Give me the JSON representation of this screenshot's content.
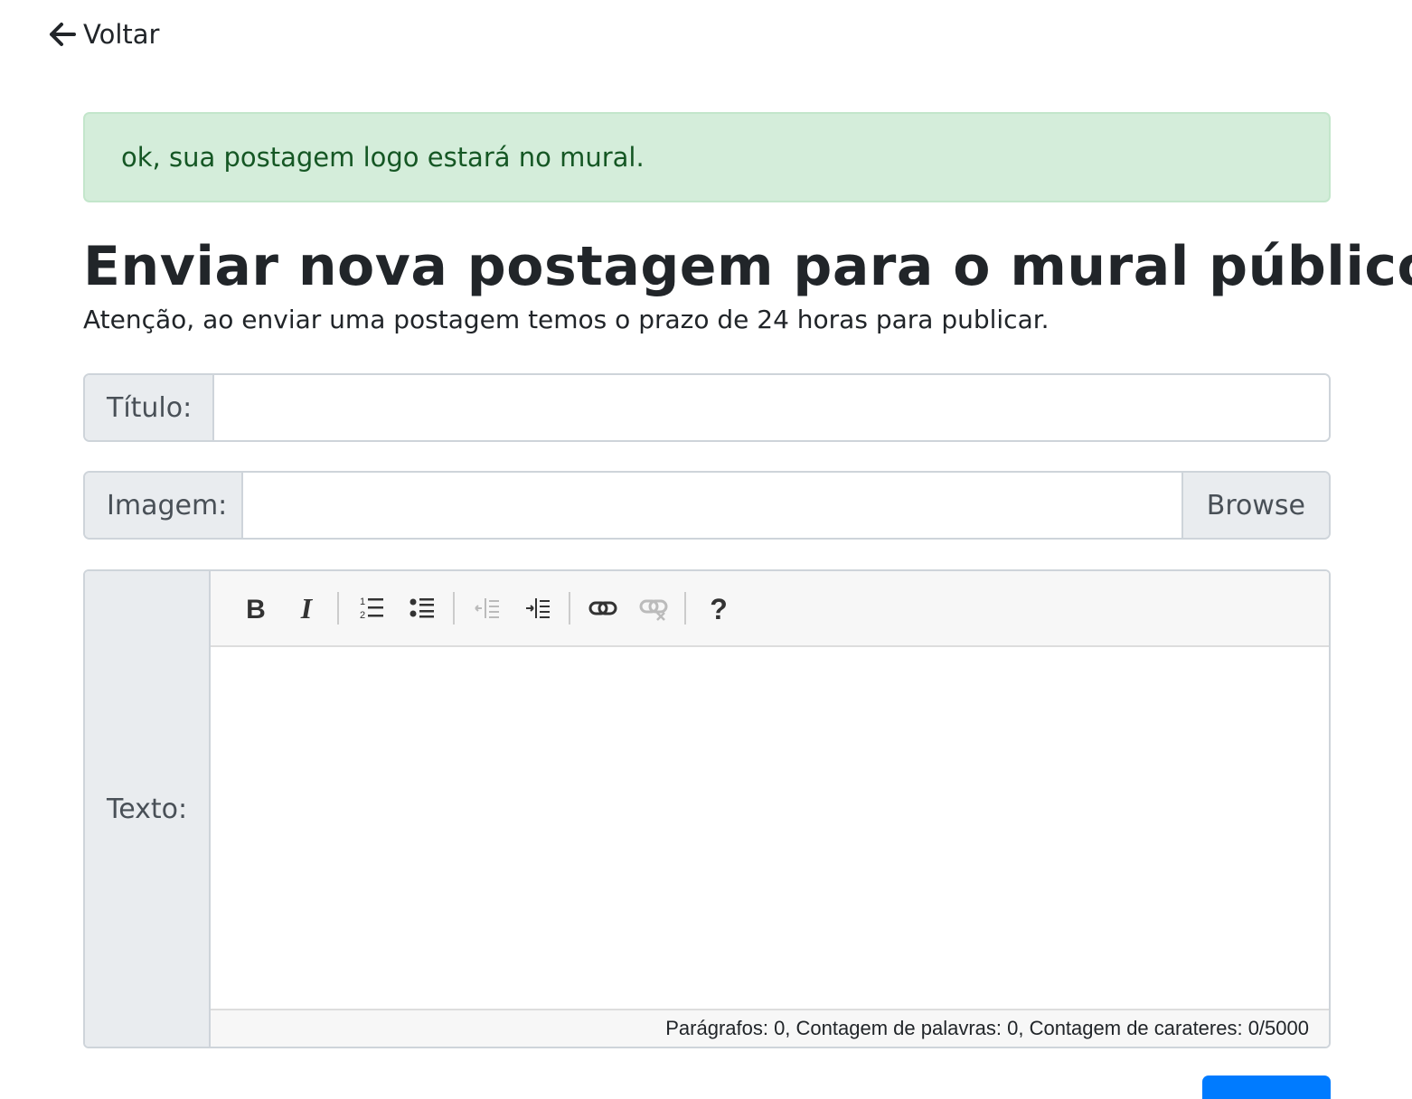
{
  "nav": {
    "back_label": "Voltar",
    "back_icon": "arrow-left-icon"
  },
  "alert": {
    "message": "ok, sua postagem logo estará no mural.",
    "background": "#d4edda",
    "color": "#155724"
  },
  "header": {
    "title": "Enviar nova postagem para o mural público:",
    "subtitle": "Atenção, ao enviar uma postagem temos o prazo de 24 horas para publicar."
  },
  "form": {
    "title_label": "Título:",
    "title_value": "",
    "image_label": "Imagem:",
    "image_value": "",
    "browse_label": "Browse",
    "text_label": "Texto:",
    "toolbar": {
      "buttons": [
        {
          "name": "bold",
          "icon": "bold-icon",
          "enabled": true
        },
        {
          "name": "italic",
          "icon": "italic-icon",
          "enabled": true
        },
        {
          "name": "ordered-list",
          "icon": "ordered-list-icon",
          "enabled": true
        },
        {
          "name": "unordered-list",
          "icon": "unordered-list-icon",
          "enabled": true
        },
        {
          "name": "outdent",
          "icon": "outdent-icon",
          "enabled": false
        },
        {
          "name": "indent",
          "icon": "indent-icon",
          "enabled": true
        },
        {
          "name": "link",
          "icon": "link-icon",
          "enabled": true
        },
        {
          "name": "unlink",
          "icon": "unlink-icon",
          "enabled": false
        },
        {
          "name": "help",
          "icon": "help-icon",
          "enabled": true
        }
      ]
    },
    "status": "Parágrafos: 0, Contagem de palavras: 0, Contagem de carateres: 0/5000"
  },
  "colors": {
    "primary": "#007bff",
    "label_bg": "#e9ecef",
    "border": "#ced4da"
  }
}
